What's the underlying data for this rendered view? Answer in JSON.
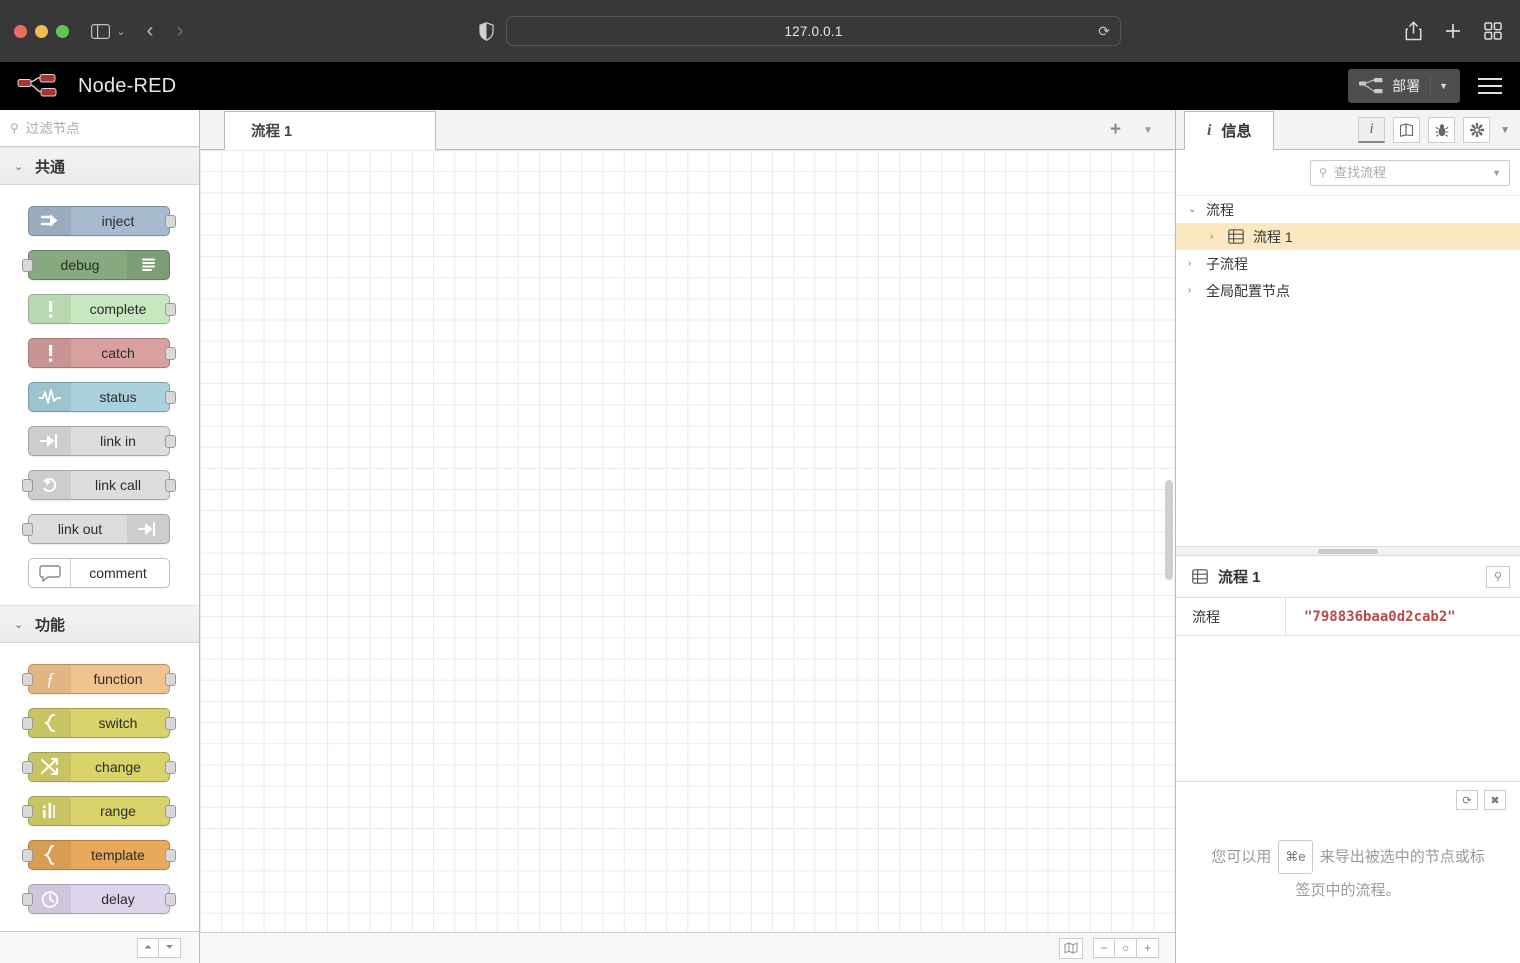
{
  "browser": {
    "url": "127.0.0.1",
    "icons": {
      "sidebar_toggle": "sidebar-toggle-icon",
      "tab_overview_caret": "chevron-down-icon",
      "back": "chevron-left-icon",
      "forward": "chevron-right-icon",
      "privacy_shield": "shield-icon",
      "reload": "reload-icon",
      "share": "share-icon",
      "new_tab": "plus-icon",
      "tab_grid": "grid-icon"
    }
  },
  "header": {
    "title": "Node-RED",
    "deploy_label": "部署",
    "deploy_caret": "▼",
    "menu_icon": "hamburger-menu-icon"
  },
  "palette": {
    "search_placeholder": "过滤节点",
    "search_value": "",
    "collapse_all": "chevron-double-up-icon",
    "expand_all": "chevron-double-down-icon",
    "categories": [
      {
        "title": "共通",
        "caret": "⌄",
        "nodes": [
          {
            "label": "inject",
            "bg": "#a6bbcf",
            "icon": "inject-arrow-icon",
            "icon_side": "left",
            "ports": [
              "out"
            ]
          },
          {
            "label": "debug",
            "bg": "#87a980",
            "icon": "debug-lines-icon",
            "icon_side": "right",
            "ports": [
              "in"
            ]
          },
          {
            "label": "complete",
            "bg": "#c7e9c0",
            "icon": "alert-bang-icon",
            "icon_side": "left",
            "ports": [
              "out"
            ]
          },
          {
            "label": "catch",
            "bg": "#d9a0a0",
            "icon": "alert-bang-icon",
            "icon_side": "left",
            "ports": [
              "out"
            ]
          },
          {
            "label": "status",
            "bg": "#a9d2de",
            "icon": "pulse-wave-icon",
            "icon_side": "left",
            "ports": [
              "out"
            ]
          },
          {
            "label": "link in",
            "bg": "#dddddd",
            "icon": "link-in-icon",
            "icon_side": "left",
            "ports": [
              "out"
            ]
          },
          {
            "label": "link call",
            "bg": "#dddddd",
            "icon": "link-call-icon",
            "icon_side": "left",
            "ports": [
              "in",
              "out"
            ]
          },
          {
            "label": "link out",
            "bg": "#dddddd",
            "icon": "link-out-icon",
            "icon_side": "right",
            "ports": [
              "in"
            ]
          },
          {
            "label": "comment",
            "bg": "#ffffff",
            "icon": "comment-bubble-icon",
            "icon_side": "left",
            "ports": []
          }
        ]
      },
      {
        "title": "功能",
        "caret": "⌄",
        "nodes": [
          {
            "label": "function",
            "bg": "#f2c48d",
            "icon": "function-f-icon",
            "icon_side": "left",
            "ports": [
              "in",
              "out"
            ]
          },
          {
            "label": "switch",
            "bg": "#d9d36b",
            "icon": "switch-fork-icon",
            "icon_side": "left",
            "ports": [
              "in",
              "out"
            ]
          },
          {
            "label": "change",
            "bg": "#d9d36b",
            "icon": "change-swap-icon",
            "icon_side": "left",
            "ports": [
              "in",
              "out"
            ]
          },
          {
            "label": "range",
            "bg": "#d9d36b",
            "icon": "range-bars-icon",
            "icon_side": "left",
            "ports": [
              "in",
              "out"
            ]
          },
          {
            "label": "template",
            "bg": "#e8a95a",
            "icon": "brace-icon",
            "icon_side": "left",
            "ports": [
              "in",
              "out"
            ]
          },
          {
            "label": "delay",
            "bg": "#ded5ec",
            "icon": "clock-icon",
            "icon_side": "left",
            "ports": [
              "in",
              "out"
            ]
          }
        ]
      }
    ]
  },
  "workspace": {
    "tabs": [
      {
        "label": "流程 1",
        "active": true
      }
    ],
    "add_tab_icon": "plus-icon",
    "tab_menu_icon": "chevron-down-icon",
    "footer": {
      "navigator_icon": "map-icon",
      "zoom_out": "−",
      "zoom_reset": "○",
      "zoom_in": "+"
    }
  },
  "sidebar": {
    "tab_label": "信息",
    "tab_icon": "info-i-icon",
    "tool_icons": [
      {
        "name": "info-icon",
        "glyph": "i",
        "active": true
      },
      {
        "name": "help-book-icon",
        "glyph": "book",
        "active": false
      },
      {
        "name": "debug-bug-icon",
        "glyph": "bug",
        "active": false
      },
      {
        "name": "config-gear-icon",
        "glyph": "gear",
        "active": false
      }
    ],
    "tools_caret": "▼",
    "search_placeholder": "查找流程",
    "search_value": "",
    "search_caret": "▼",
    "tree": [
      {
        "label": "流程",
        "level": 0,
        "caret": "⌄",
        "selected": false,
        "icon": null
      },
      {
        "label": "流程 1",
        "level": 1,
        "caret": "›",
        "selected": true,
        "icon": "flow-tab-icon"
      },
      {
        "label": "子流程",
        "level": 0,
        "caret": "›",
        "selected": false,
        "icon": null
      },
      {
        "label": "全局配置节点",
        "level": 0,
        "caret": "›",
        "selected": false,
        "icon": null
      }
    ],
    "properties": {
      "title": "流程 1",
      "title_icon": "flow-tab-icon",
      "search_icon": "search-icon",
      "rows": [
        {
          "key": "流程",
          "value": "\"798836baa0d2cab2\""
        }
      ]
    },
    "tip": {
      "refresh_icon": "refresh-icon",
      "close_icon": "close-icon",
      "text_before": "您可以用",
      "kbd": "⌘e",
      "text_after": "来导出被选中的节点或标签页中的流程。"
    }
  },
  "colors": {
    "header_bg": "#000000",
    "chrome_bg": "#383838",
    "selected_tree": "#fbe8c0",
    "flow_id_text": "#b94a48",
    "deploy_bg": "#4e4e4e"
  }
}
